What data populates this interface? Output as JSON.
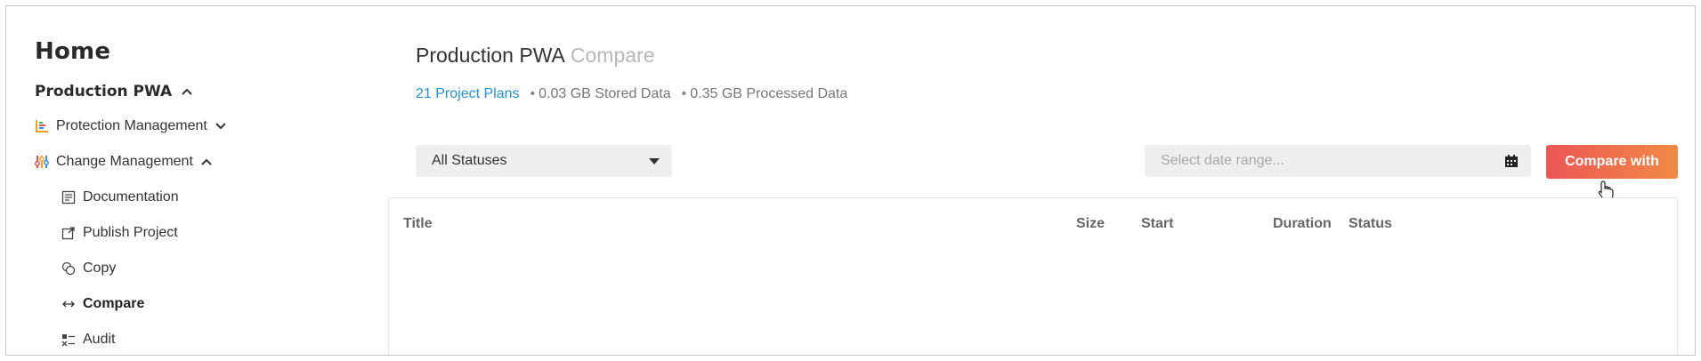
{
  "sidebar": {
    "home": "Home",
    "pwa_label": "Production PWA",
    "items": [
      {
        "label": "Protection Management",
        "icon": "protection-icon",
        "expanded": false
      },
      {
        "label": "Change Management",
        "icon": "change-management-icon",
        "expanded": true
      },
      {
        "label": "Documentation",
        "icon": "document-icon"
      },
      {
        "label": "Publish Project",
        "icon": "publish-icon"
      },
      {
        "label": "Copy",
        "icon": "copy-icon"
      },
      {
        "label": "Compare",
        "icon": "compare-arrows-icon",
        "active": true
      },
      {
        "label": "Audit",
        "icon": "audit-icon"
      }
    ]
  },
  "main": {
    "title": "Production PWA",
    "subtitle": "Compare",
    "stats": {
      "plans": "21 Project Plans",
      "stored": "0.03 GB Stored Data",
      "processed": "0.35 GB Processed Data"
    },
    "status_filter": {
      "selected": "All Statuses"
    },
    "date_range": {
      "placeholder": "Select date range..."
    },
    "compare_button": "Compare with",
    "table": {
      "columns": [
        "Title",
        "Size",
        "Start",
        "Duration",
        "Status"
      ],
      "rows": []
    }
  },
  "colors": {
    "link": "#2a8fd0",
    "button_gradient_start": "#ec5656",
    "button_gradient_end": "#f08a45",
    "input_bg": "#efefef"
  }
}
